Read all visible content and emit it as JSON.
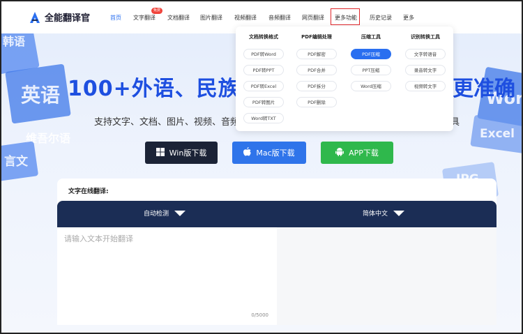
{
  "brand": {
    "name": "全能翻译官"
  },
  "nav": {
    "items": [
      {
        "label": "首页",
        "active": true
      },
      {
        "label": "文字翻译",
        "badge": "免费"
      },
      {
        "label": "文档翻译"
      },
      {
        "label": "图片翻译"
      },
      {
        "label": "视频翻译"
      },
      {
        "label": "音频翻译"
      },
      {
        "label": "网页翻译"
      },
      {
        "label": "更多功能",
        "highlighted": true
      },
      {
        "label": "历史记录"
      },
      {
        "label": "更多"
      }
    ]
  },
  "background_words": [
    "韩语",
    "英语",
    "维吾尔语",
    "言文",
    "Wor",
    "Excel",
    "JPG"
  ],
  "hero": {
    "title": "100+外语、民族语",
    "title_end": "更准确",
    "subtitle": "支持文字、文档、图片、视频、音频",
    "subtitle_end": "具"
  },
  "downloads": [
    {
      "label": "Win版下载",
      "icon": "windows-icon",
      "color": "#1b2336"
    },
    {
      "label": "Mac版下载",
      "icon": "apple-icon",
      "color": "#2f74ea"
    },
    {
      "label": "APP下载",
      "icon": "android-icon",
      "color": "#2fb84c"
    }
  ],
  "dropdown": {
    "columns": [
      {
        "header": "文档转换格式",
        "items": [
          "PDF转Word",
          "PDF转PPT",
          "PDF转Excel",
          "PDF转图片",
          "Word转TXT"
        ]
      },
      {
        "header": "PDF编辑处理",
        "items": [
          "PDF解密",
          "PDF合并",
          "PDF拆分",
          "PDF删除"
        ]
      },
      {
        "header": "压缩工具",
        "items": [
          "PDF压缩",
          "PPT压缩",
          "Word压缩"
        ],
        "selected": "PDF压缩"
      },
      {
        "header": "识别转换工具",
        "items": [
          "文字转语音",
          "录音转文字",
          "视频转文字"
        ]
      }
    ]
  },
  "translator": {
    "label": "文字在线翻译:",
    "source_lang": "自动检测",
    "target_lang": "简体中文",
    "placeholder": "请输入文本开始翻译",
    "counter": "0/5000"
  },
  "colors": {
    "accent": "#2a6ff0",
    "lang_bar": "#1b2d55",
    "highlight_box": "#e0262a"
  }
}
